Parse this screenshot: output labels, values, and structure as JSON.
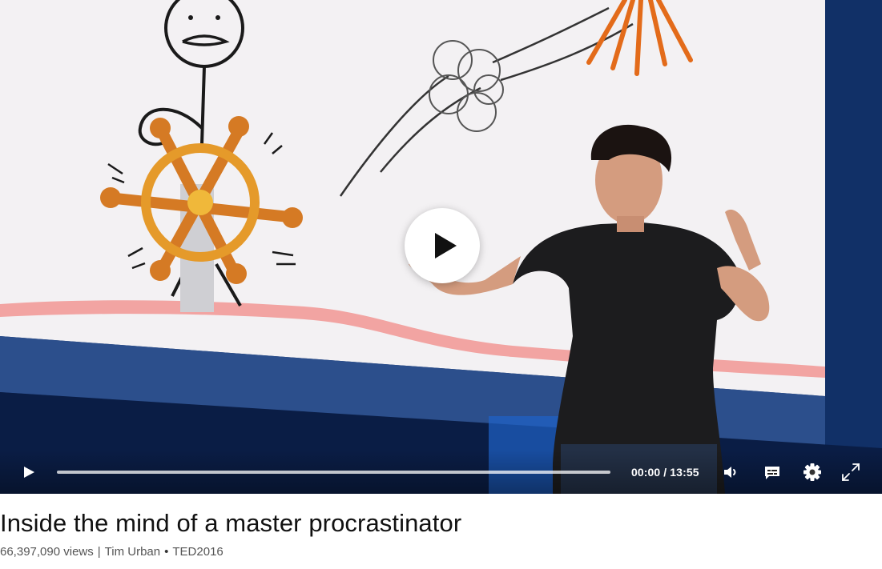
{
  "video": {
    "play_state": "paused",
    "current_time": "00:00",
    "duration": "13:55",
    "time_separator": " / ",
    "progress_fraction": 0
  },
  "controls": {
    "play_icon": "play-icon",
    "volume_icon": "volume-icon",
    "captions_icon": "captions-icon",
    "settings_icon": "gear-icon",
    "fullscreen_icon": "fullscreen-icon"
  },
  "talk": {
    "title": "Inside the mind of a master procrastinator",
    "views": "66,397,090 views",
    "separator": "|",
    "speaker": "Tim Urban",
    "bullet": "•",
    "event": "TED2016"
  },
  "colors": {
    "controls_text": "#ffffff",
    "title_text": "#111111",
    "meta_text": "#555555"
  }
}
